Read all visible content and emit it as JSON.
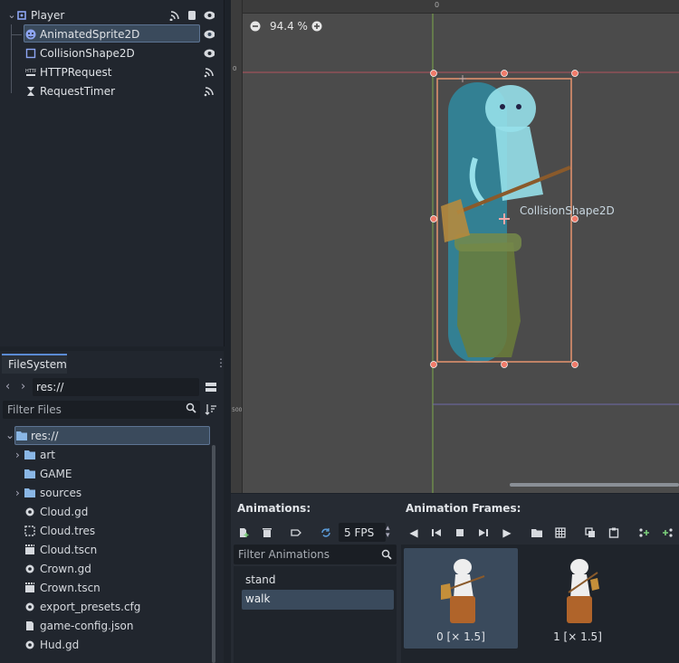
{
  "scene_tree": {
    "nodes": [
      {
        "label": "Player",
        "icon": "node2d-icon"
      },
      {
        "label": "AnimatedSprite2D",
        "icon": "animated-sprite-icon"
      },
      {
        "label": "CollisionShape2D",
        "icon": "collision-shape-icon"
      },
      {
        "label": "HTTPRequest",
        "icon": "http-request-icon"
      },
      {
        "label": "RequestTimer",
        "icon": "timer-icon"
      }
    ]
  },
  "filesystem": {
    "tab_label": "FileSystem",
    "path": "res://",
    "filter_placeholder": "Filter Files",
    "root_label": "res://",
    "items": [
      {
        "label": "art",
        "icon": "folder-icon"
      },
      {
        "label": "GAME",
        "icon": "folder-icon"
      },
      {
        "label": "sources",
        "icon": "folder-icon"
      },
      {
        "label": "Cloud.gd",
        "icon": "gear-icon"
      },
      {
        "label": "Cloud.tres",
        "icon": "resource-icon"
      },
      {
        "label": "Cloud.tscn",
        "icon": "scene-icon"
      },
      {
        "label": "Crown.gd",
        "icon": "gear-icon"
      },
      {
        "label": "Crown.tscn",
        "icon": "scene-icon"
      },
      {
        "label": "export_presets.cfg",
        "icon": "gear-icon"
      },
      {
        "label": "game-config.json",
        "icon": "file-icon"
      },
      {
        "label": "Hud.gd",
        "icon": "gear-icon"
      }
    ]
  },
  "viewport": {
    "zoom": "94.4 %",
    "ruler_top_zero": "0",
    "ruler_left_zero": "0",
    "ruler_left_500": "500",
    "collision_label": "CollisionShape2D"
  },
  "animations": {
    "header": "Animations:",
    "fps": "5 FPS",
    "filter_placeholder": "Filter Animations",
    "list": [
      "stand",
      "walk"
    ],
    "selected": "walk"
  },
  "frames": {
    "header": "Animation Frames:",
    "items": [
      {
        "label": "0 [× 1.5]"
      },
      {
        "label": "1 [× 1.5]"
      }
    ]
  },
  "colors": {
    "accent": "#5b8bd4",
    "selection": "#3a4a5c",
    "handle": "#f07b6a",
    "shape": "#2f8aa0"
  }
}
